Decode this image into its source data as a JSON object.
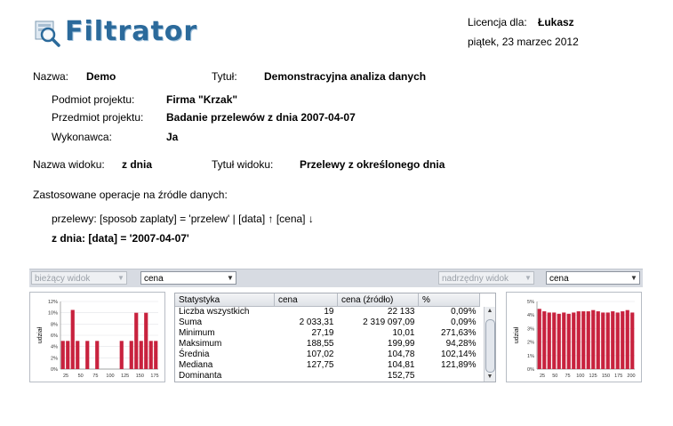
{
  "header": {
    "logo_text": "Filtrator",
    "license_label": "Licencja dla:",
    "license_user": "Łukasz",
    "date": "piątek, 23 marzec 2012"
  },
  "project": {
    "name_label": "Nazwa:",
    "name_value": "Demo",
    "title_label": "Tytuł:",
    "title_value": "Demonstracyjna analiza danych",
    "subject_label": "Podmiot projektu:",
    "subject_value": "Firma \"Krzak\"",
    "object_label": "Przedmiot projektu:",
    "object_value": "Badanie przelewów z dnia 2007-04-07",
    "contractor_label": "Wykonawca:",
    "contractor_value": "Ja"
  },
  "view": {
    "name_label": "Nazwa widoku:",
    "name_value": "z dnia",
    "title_label": "Tytuł widoku:",
    "title_value": "Przelewy z określonego dnia"
  },
  "operations": {
    "heading": "Zastosowane operacje na źródle danych:",
    "line1": "przelewy:  [sposob zaplaty] = 'przelew'  |  [data] ↑ [cena] ↓",
    "line2": "z dnia:  [data] = '2007-04-07'"
  },
  "panel": {
    "left_view_combo": "bieżący widok",
    "left_field_combo": "cena",
    "right_view_combo": "nadrzędny widok",
    "right_field_combo": "cena",
    "arrow_glyph": "▼"
  },
  "stats_table": {
    "headers": [
      "Statystyka",
      "cena",
      "cena (źródło)",
      "%"
    ],
    "rows": [
      [
        "Liczba wszystkich",
        "19",
        "22 133",
        "0,09%"
      ],
      [
        "Suma",
        "2 033,31",
        "2 319 097,09",
        "0,09%"
      ],
      [
        "Minimum",
        "27,19",
        "10,01",
        "271,63%"
      ],
      [
        "Maksimum",
        "188,55",
        "199,99",
        "94,28%"
      ],
      [
        "Średnia",
        "107,02",
        "104,78",
        "102,14%"
      ],
      [
        "Mediana",
        "127,75",
        "104,81",
        "121,89%"
      ],
      [
        "Dominanta",
        "",
        "152,75",
        ""
      ]
    ]
  },
  "chart_data": [
    {
      "type": "bar",
      "ylabel": "udział",
      "ytick_labels": [
        "0%",
        "2%",
        "4%",
        "6%",
        "8%",
        "10%",
        "12%"
      ],
      "xtick_labels": [
        "25",
        "50",
        "75",
        "100",
        "125",
        "150",
        "175"
      ],
      "ylim": [
        0,
        12
      ],
      "values": [
        5,
        5,
        10.5,
        5,
        0,
        5,
        0,
        5,
        0,
        0,
        0,
        0,
        5,
        0,
        5,
        10,
        5,
        10,
        5,
        5
      ],
      "color": "#c8223e"
    },
    {
      "type": "bar",
      "ylabel": "udział",
      "ytick_labels": [
        "0%",
        "1%",
        "2%",
        "3%",
        "4%",
        "5%"
      ],
      "xtick_labels": [
        "25",
        "50",
        "75",
        "100",
        "125",
        "150",
        "175",
        "200"
      ],
      "ylim": [
        0,
        5.5
      ],
      "values": [
        4.9,
        4.7,
        4.6,
        4.6,
        4.5,
        4.6,
        4.5,
        4.6,
        4.7,
        4.7,
        4.7,
        4.8,
        4.7,
        4.6,
        4.6,
        4.7,
        4.6,
        4.7,
        4.8,
        4.6
      ],
      "color": "#c8223e"
    }
  ]
}
